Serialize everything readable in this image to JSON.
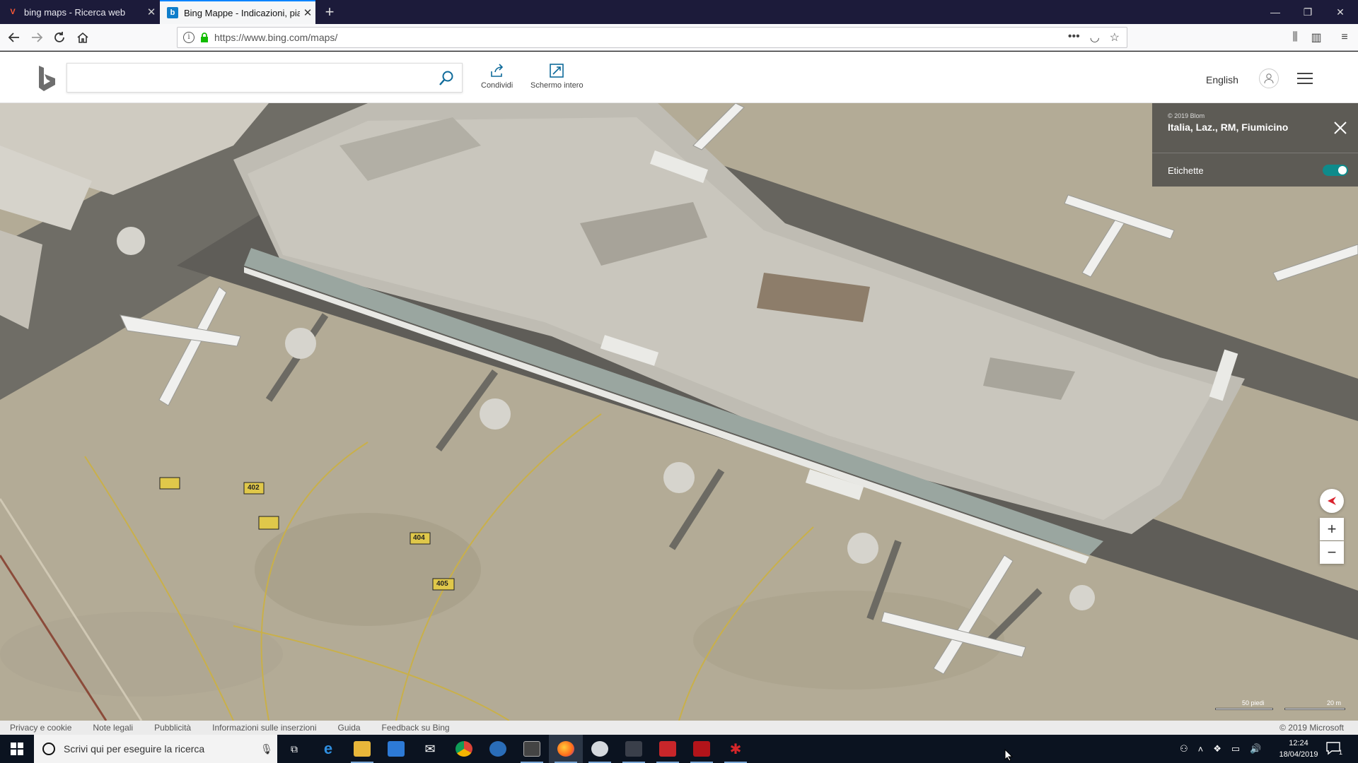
{
  "browser": {
    "tabs": [
      {
        "title": "bing maps - Ricerca web",
        "favicon": "V"
      },
      {
        "title": "Bing Mappe - Indicazioni, piani",
        "favicon": "b"
      }
    ],
    "url": "https://www.bing.com/maps/"
  },
  "bing": {
    "search_placeholder": "",
    "share_label": "Condividi",
    "fullscreen_label": "Schermo intero",
    "language": "English"
  },
  "map": {
    "imagery_copyright": "© 2019 Blom",
    "location": "Italia, Laz., RM, Fiumicino",
    "labels_toggle": "Etichette",
    "labels_on": true,
    "scale_feet": "50 piedi",
    "scale_meters": "20 m",
    "zoom_in": "+",
    "zoom_out": "−",
    "taxi_signs": [
      "402",
      "404",
      "405"
    ]
  },
  "footer": {
    "links": [
      "Privacy e cookie",
      "Note legali",
      "Pubblicità",
      "Informazioni sulle inserzioni",
      "Guida",
      "Feedback su Bing"
    ],
    "copyright": "© 2019 Microsoft"
  },
  "taskbar": {
    "search_text": "Scrivi qui per eseguire la ricerca",
    "time": "12:24",
    "date": "18/04/2019",
    "notifications": "1"
  },
  "colors": {
    "accent": "#0a84ff",
    "tabbar_bg": "#1c1b3a",
    "taskbar_bg": "#0b1320",
    "toggle_on": "#0e8b8b",
    "tarmac": "#b5ad98"
  }
}
